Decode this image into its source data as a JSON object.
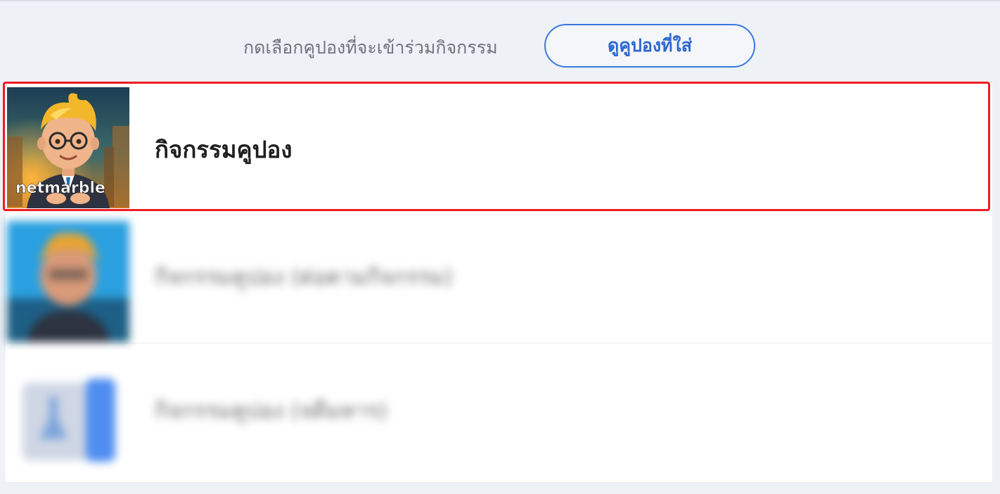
{
  "header": {
    "instruction": "กดเลือกคูปองที่จะเข้าร่วมกิจกรรม",
    "view_coupons_button": "ดูคูปองที่ใส่"
  },
  "events": [
    {
      "title": "กิจกรรมคูปอง",
      "thumbnail_caption": "netmarble",
      "selected": true,
      "blurred": false
    },
    {
      "title": "กิจกรรมคูปอง (ต่อตามกิจกรรม)",
      "selected": false,
      "blurred": true
    },
    {
      "title": "กิจกรรมคูปอง (จดีมหาร)",
      "selected": false,
      "blurred": true
    }
  ],
  "colors": {
    "page_bg": "#eef1f5",
    "accent_blue": "#3a78e0",
    "selection_red": "#ee1c25"
  }
}
